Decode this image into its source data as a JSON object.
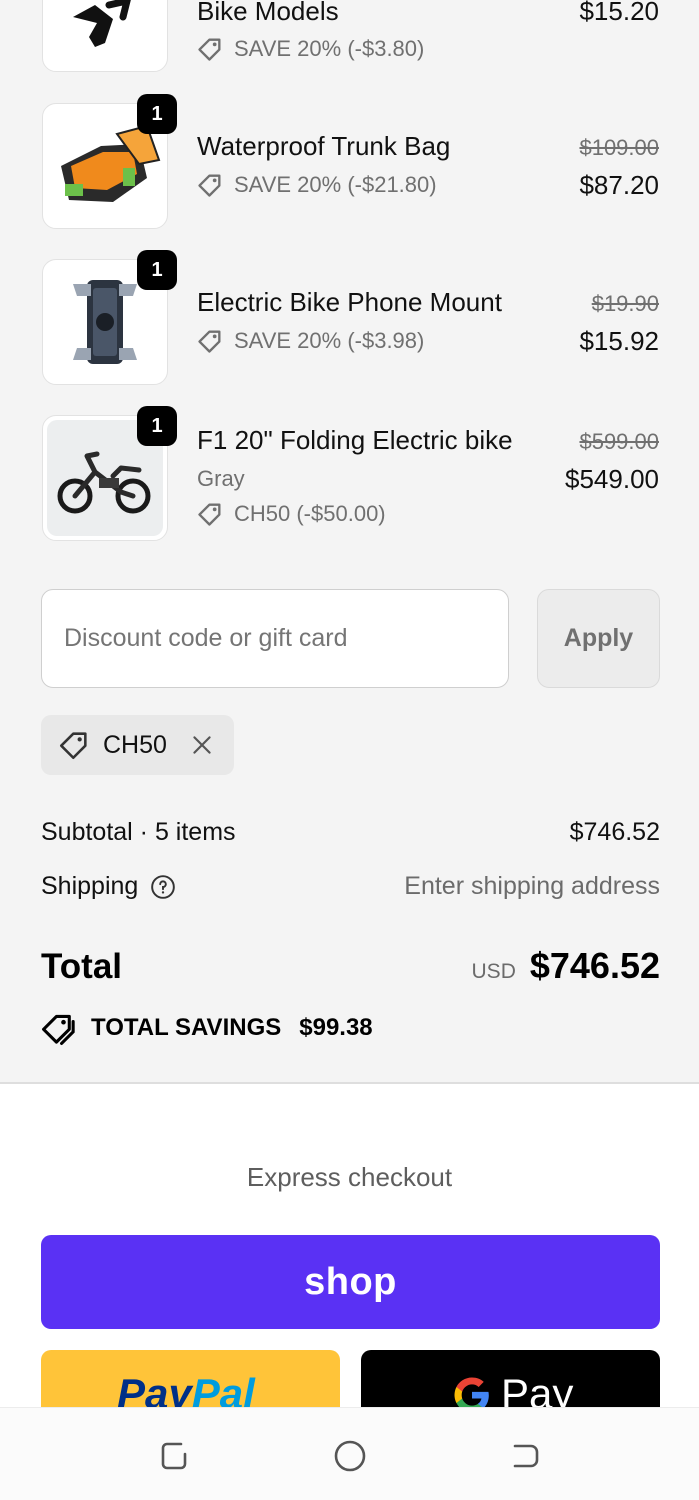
{
  "items": [
    {
      "name": "Bike Models",
      "discount": "SAVE 20% (-$3.80)",
      "price": "$15.20",
      "image_icon": "bottle-cage-icon"
    },
    {
      "name": "Waterproof Trunk Bag",
      "discount": "SAVE 20% (-$21.80)",
      "original_price": "$109.00",
      "price": "$87.20",
      "quantity": "1",
      "image_icon": "trunk-bag-icon"
    },
    {
      "name": "Electric Bike Phone Mount",
      "discount": "SAVE 20% (-$3.98)",
      "original_price": "$19.90",
      "price": "$15.92",
      "quantity": "1",
      "image_icon": "phone-mount-icon"
    },
    {
      "name": "F1 20\" Folding Electric bike",
      "variant": "Gray",
      "discount": "CH50 (-$50.00)",
      "original_price": "$599.00",
      "price": "$549.00",
      "quantity": "1",
      "image_icon": "folding-ebike-icon"
    }
  ],
  "discount_form": {
    "placeholder": "Discount code or gift card",
    "value": "",
    "apply_label": "Apply",
    "applied_code": "CH50"
  },
  "summary": {
    "subtotal_label": "Subtotal · 5 items",
    "subtotal_value": "$746.52",
    "shipping_label": "Shipping",
    "shipping_value": "Enter shipping address",
    "total_label": "Total",
    "currency": "USD",
    "total_value": "$746.52",
    "savings_label": "TOTAL SAVINGS",
    "savings_value": "$99.38"
  },
  "express": {
    "label": "Express checkout",
    "shop_label": "shop",
    "paypal_label_1": "Pay",
    "paypal_label_2": "Pal",
    "gpay_label": "Pay"
  },
  "colors": {
    "shop_purple": "#5a31f4",
    "paypal_yellow": "#ffc439",
    "gpay_black": "#000000",
    "summary_bg": "#f4f4f4"
  }
}
